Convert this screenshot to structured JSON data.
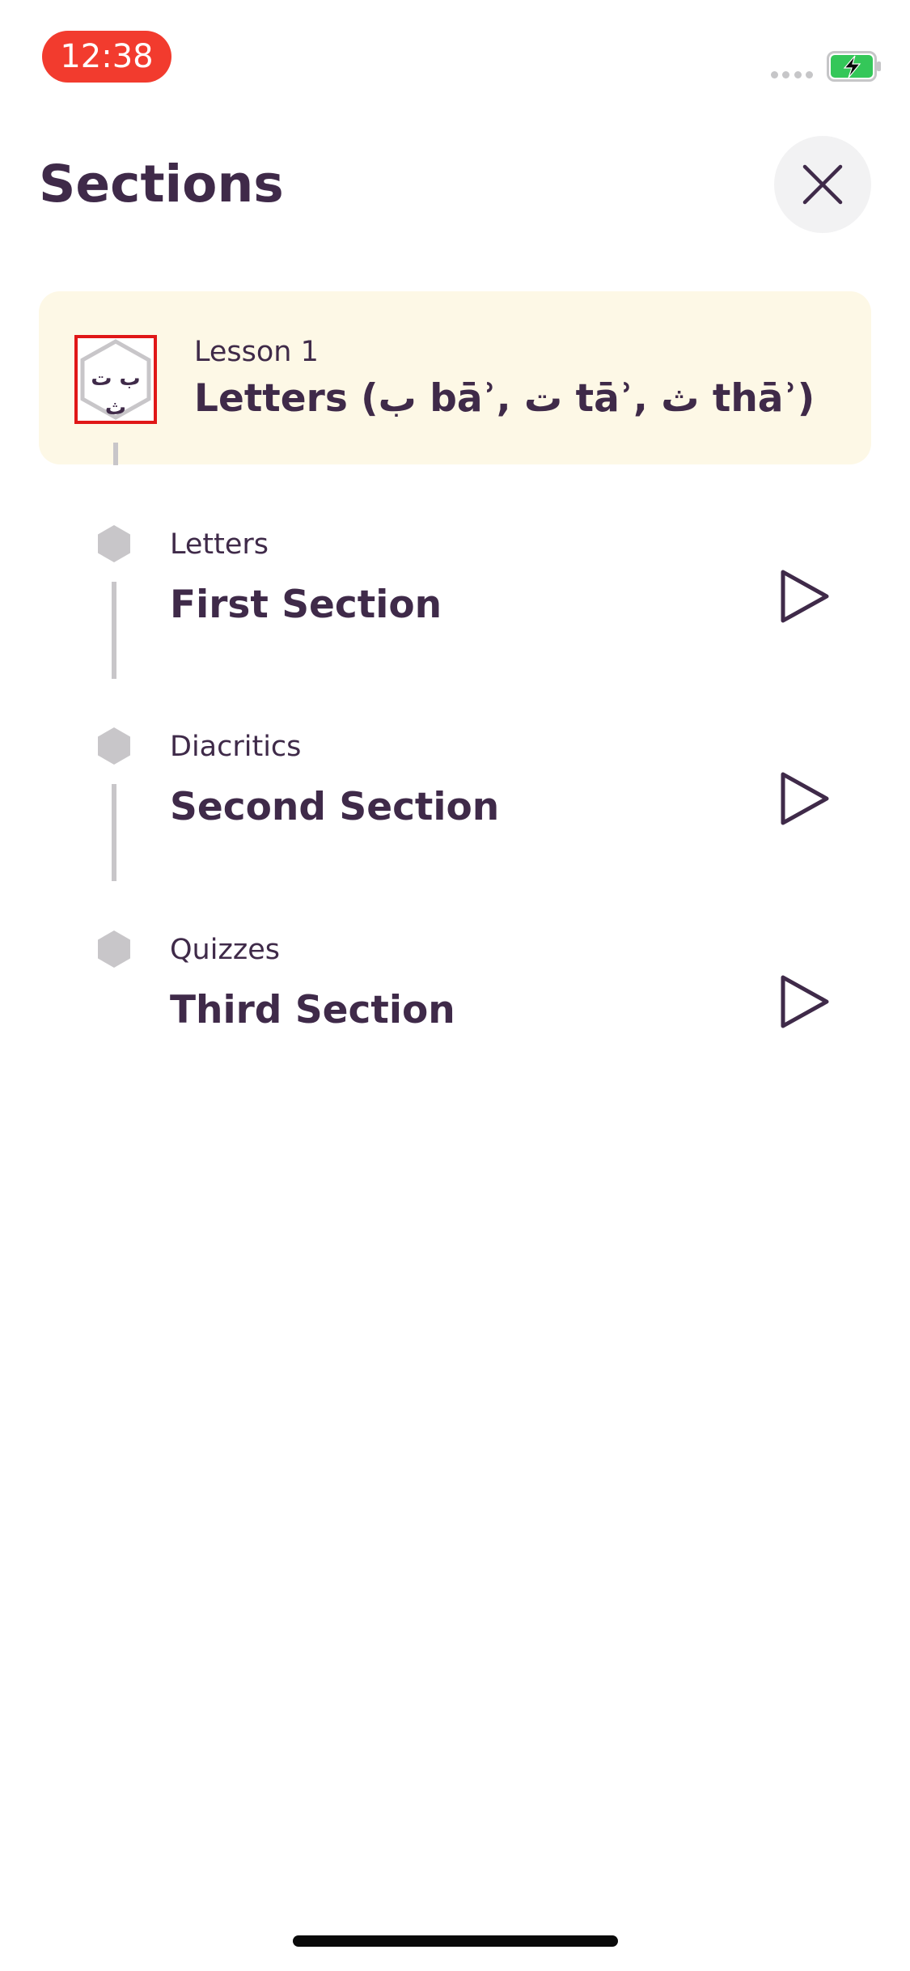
{
  "status_bar": {
    "time": "12:38"
  },
  "header": {
    "title": "Sections",
    "close_icon": "close-icon"
  },
  "lesson": {
    "kicker": "Lesson 1",
    "title": "Letters (ب bāʾ, ت tāʾ, ث thāʾ)",
    "badge_text": "ب ت ث"
  },
  "sections": [
    {
      "kicker": "Letters",
      "title": "First Section"
    },
    {
      "kicker": "Diacritics",
      "title": "Second Section"
    },
    {
      "kicker": "Quizzes",
      "title": "Third Section"
    }
  ],
  "colors": {
    "text": "#3f2a49",
    "card_background": "#fdf8e6",
    "time_pill": "#f23b2e",
    "timeline": "#c8c6c9",
    "battery_fill": "#34c759"
  }
}
